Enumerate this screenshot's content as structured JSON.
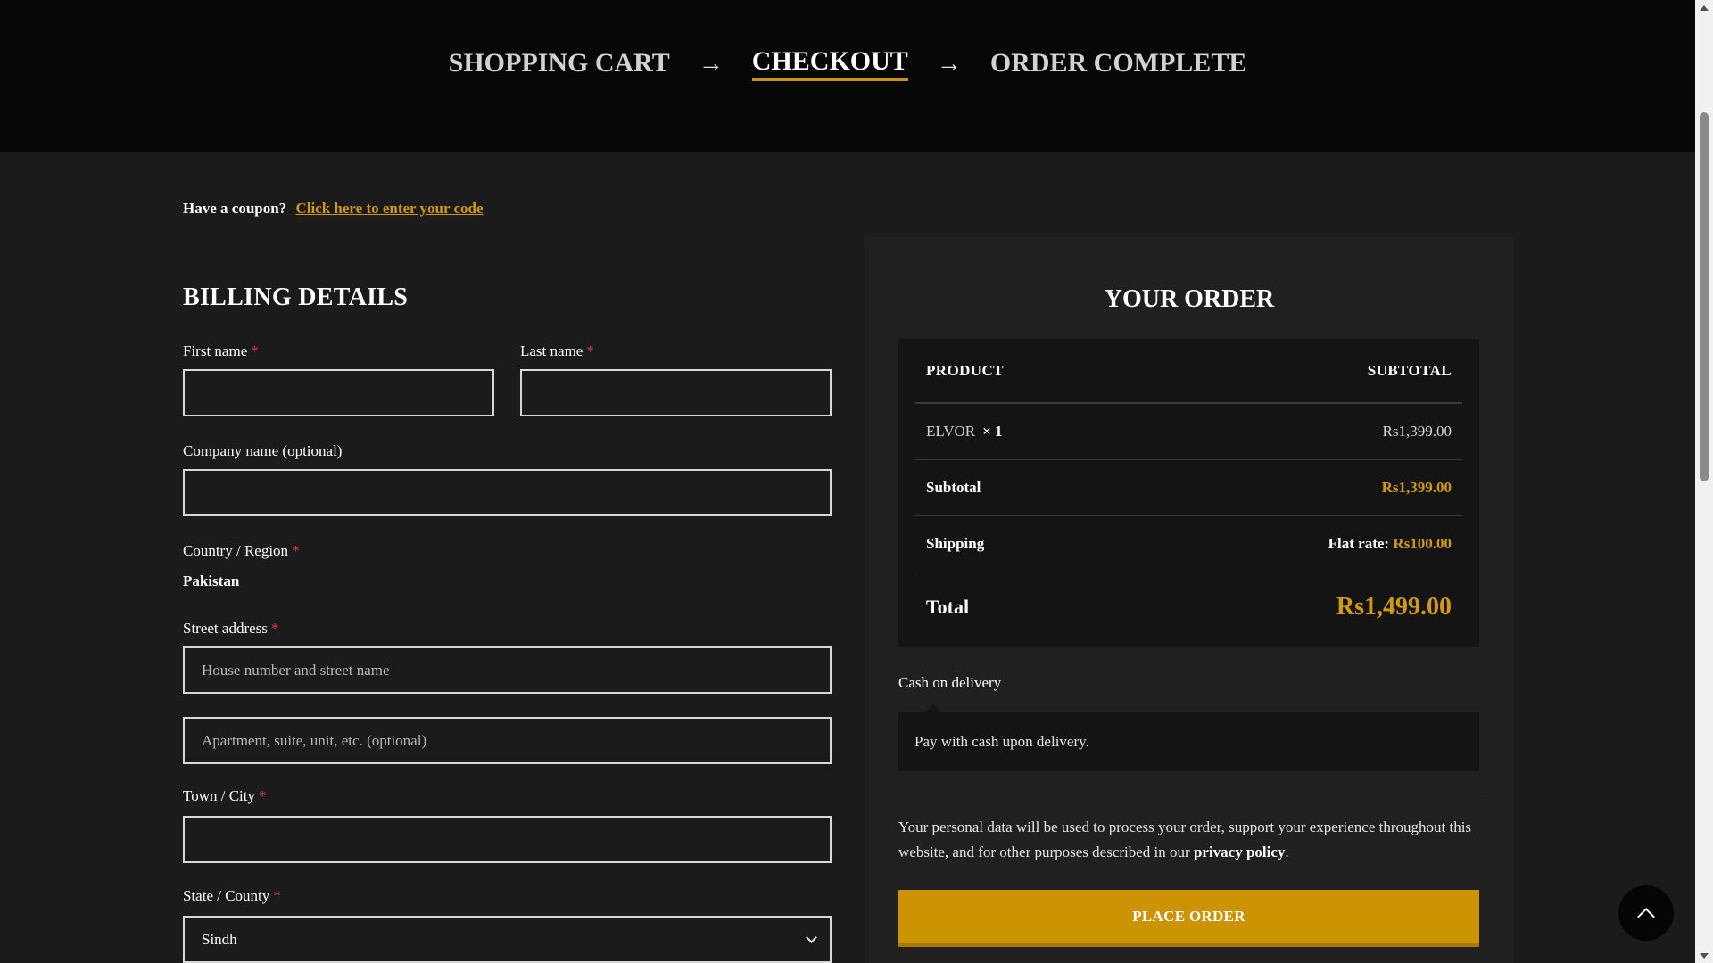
{
  "steps": {
    "cart": "SHOPPING CART",
    "checkout": "CHECKOUT",
    "complete": "ORDER COMPLETE",
    "arrow": "→"
  },
  "coupon": {
    "text": "Have a coupon?",
    "link": "Click here to enter your code"
  },
  "billing": {
    "title": "BILLING DETAILS",
    "required_mark": "*",
    "first_name_label": "First name",
    "last_name_label": "Last name",
    "company_label": "Company name (optional)",
    "country_label": "Country / Region",
    "country_value": "Pakistan",
    "street_label": "Street address",
    "street_placeholder": "House number and street name",
    "apartment_placeholder": "Apartment, suite, unit, etc. (optional)",
    "city_label": "Town / City",
    "state_label": "State / County",
    "state_value": "Sindh"
  },
  "order": {
    "title": "YOUR ORDER",
    "col_product": "PRODUCT",
    "col_subtotal": "SUBTOTAL",
    "item_name": "ELVOR",
    "item_qty": "× 1",
    "item_price": "Rs1,399.00",
    "subtotal_label": "Subtotal",
    "subtotal_value": "Rs1,399.00",
    "shipping_label": "Shipping",
    "shipping_method": "Flat rate:",
    "shipping_value": "Rs100.00",
    "total_label": "Total",
    "total_value": "Rs1,499.00"
  },
  "payment": {
    "method": "Cash on delivery",
    "description": "Pay with cash upon delivery.",
    "privacy_text": "Your personal data will be used to process your order, support your experience throughout this website, and for other purposes described in our",
    "privacy_link": "privacy policy",
    "privacy_end": ".",
    "button": "PLACE ORDER"
  },
  "colors": {
    "accent": "#cc9302",
    "background": "#1b1b1b",
    "header": "#070707",
    "required": "#e03a3a"
  },
  "icons": {
    "back_to_top": "chevron-up-icon",
    "select": "chevron-down-icon"
  }
}
